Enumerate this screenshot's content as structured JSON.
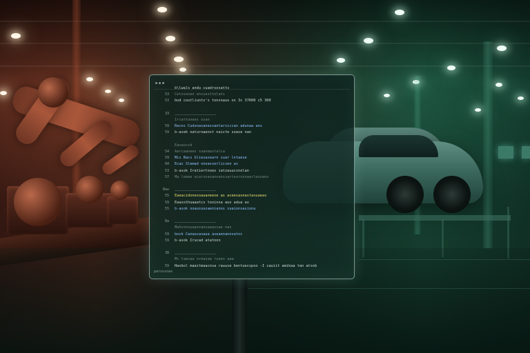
{
  "panel": {
    "lines": [
      {
        "ln": "",
        "text": "b\\lwals andu cuadrsosatts",
        "color": "c-white"
      },
      {
        "ln": "53",
        "text": "Cetosonen enssesttolats",
        "color": "c-dim"
      },
      {
        "ln": "53",
        "text": "bod coutliunts's tonsnaus os 3c 37600 c5 300",
        "color": "c-white"
      },
      {
        "ln": "",
        "text": "",
        "color": "c-dim"
      },
      {
        "ln": "33",
        "text": "",
        "color": "c-dim"
      },
      {
        "ln": "",
        "text": "Ircattonees osan",
        "color": "c-dim"
      },
      {
        "ln": "59",
        "text": "Racos Cudunasanessaotarsiccan adunaa ans",
        "color": "c-blue"
      },
      {
        "ln": "59",
        "text": "b-asek naturoaenst naicte soase nan",
        "color": "c-white"
      },
      {
        "ln": "",
        "text": "",
        "color": "c-dim"
      },
      {
        "ln": "",
        "text": "Eaoaocsd",
        "color": "c-dim"
      },
      {
        "ln": "54",
        "text": "Aarcaanees suanmastalca",
        "color": "c-dim"
      },
      {
        "ln": "59",
        "text": "Mis Racs Gliesasearn suar lntaese",
        "color": "c-blue"
      },
      {
        "ln": "84",
        "text": "Ecas Slemad onoasserlicsen as",
        "color": "c-blue"
      },
      {
        "ln": "53",
        "text": "b-asok Iratiertnoes iatzauucsnolan",
        "color": "c-white"
      },
      {
        "ln": "57",
        "text": "Ma lemae ecarsnasanoanssarteuroxnaarlesoans",
        "color": "c-dim"
      },
      {
        "ln": "",
        "text": "",
        "color": "c-dim"
      },
      {
        "ln": "Bao",
        "text": "",
        "color": "c-dim"
      },
      {
        "ln": "55",
        "text": "Eaeacidonesoauaneese as aceesasnastasuaeas",
        "color": "c-yellow"
      },
      {
        "ln": "59",
        "text": "Eaasothuaaatcs tooinsa aus adua as",
        "color": "c-white"
      },
      {
        "ln": "55",
        "text": "b-asok ooausuusaenianos suaionsasionu",
        "color": "c-blue"
      },
      {
        "ln": "",
        "text": "",
        "color": "c-dim"
      },
      {
        "ln": "8a",
        "text": "",
        "color": "c-dim"
      },
      {
        "ln": "",
        "text": "Mahsonsuaaosanuaaassae nas",
        "color": "c-dim"
      },
      {
        "ln": "59",
        "text": "bock Canaucasaua aseaenanosatoc",
        "color": "c-blue"
      },
      {
        "ln": "59",
        "text": "b-asok Irucad atatoon",
        "color": "c-white"
      },
      {
        "ln": "",
        "text": "",
        "color": "c-dim"
      },
      {
        "ln": "38",
        "text": "",
        "color": "c-dim"
      },
      {
        "ln": "",
        "text": "Ms taesaa oreasaa ruano aaa",
        "color": "c-dim"
      },
      {
        "ln": "59",
        "text": "Haobol maaitmaacnsa rauuse bentuecspso -I cauiit amikaa tan atsob",
        "color": "c-white"
      }
    ],
    "footer": "parussoas"
  }
}
